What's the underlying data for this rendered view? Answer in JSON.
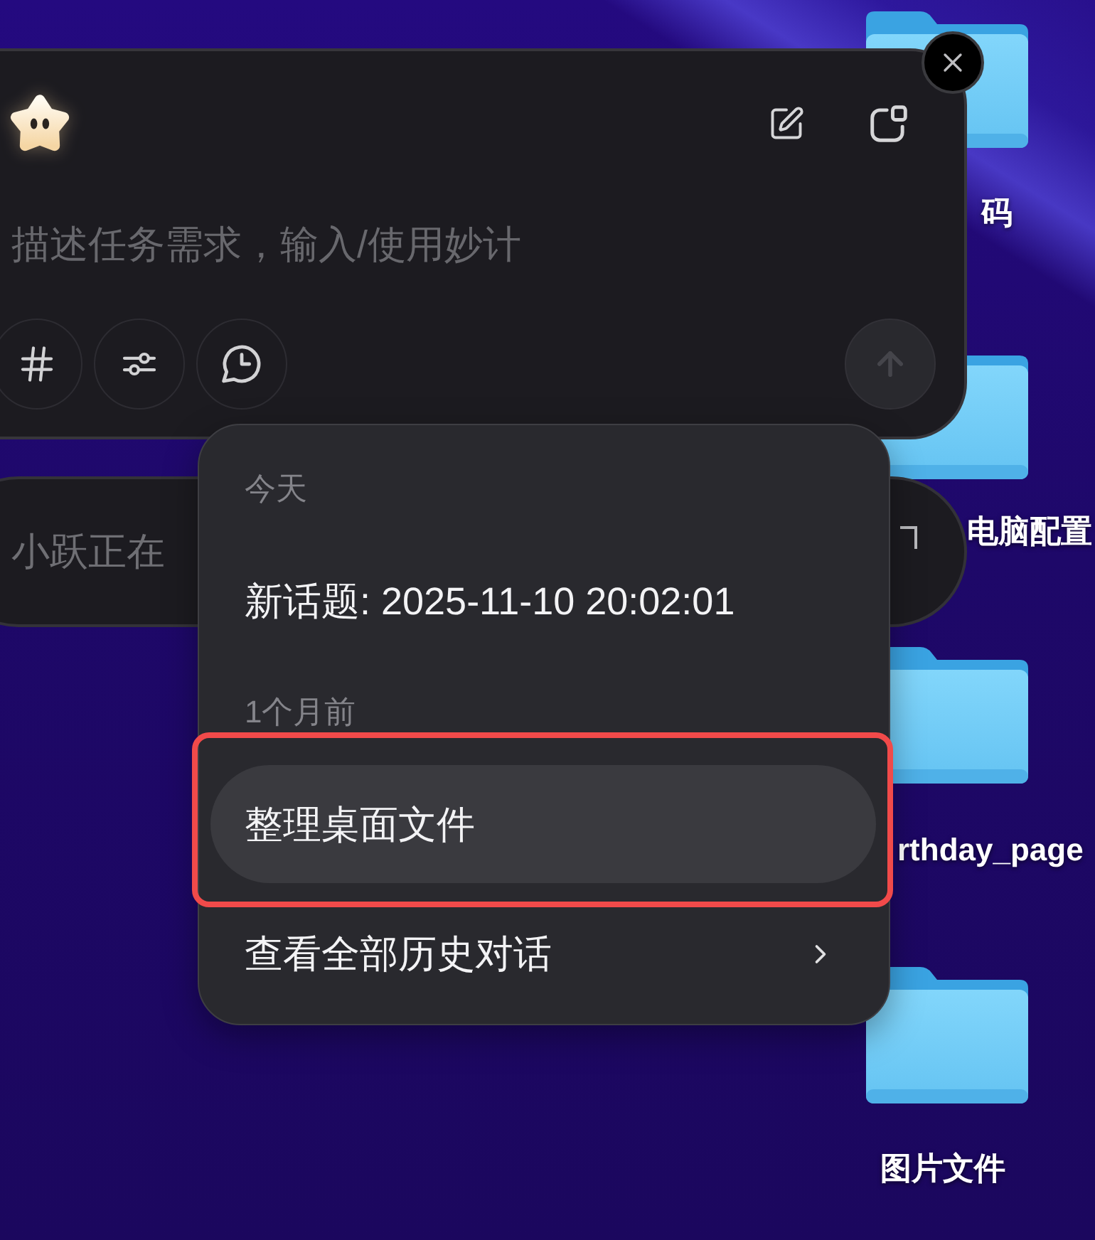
{
  "chat_panel": {
    "placeholder": "描述任务需求，输入/使用妙计",
    "send_button": {
      "disabled": true
    }
  },
  "status_panel": {
    "text": "小跃正在"
  },
  "history_menu": {
    "items": [
      {
        "kind": "header",
        "label": "今天"
      },
      {
        "kind": "item",
        "label": "新话题: 2025-11-10 20:02:01",
        "selected": false,
        "outlined": false
      },
      {
        "kind": "header",
        "label": "1个月前"
      },
      {
        "kind": "item",
        "label": "整理桌面文件",
        "selected": true,
        "outlined": true
      },
      {
        "kind": "link",
        "label": "查看全部历史对话",
        "selected": false,
        "outlined": false
      }
    ]
  },
  "desktop_icons": [
    {
      "label": "码"
    },
    {
      "label": "电脑配置"
    },
    {
      "label": "rthday_page"
    },
    {
      "label": "图片文件"
    }
  ]
}
